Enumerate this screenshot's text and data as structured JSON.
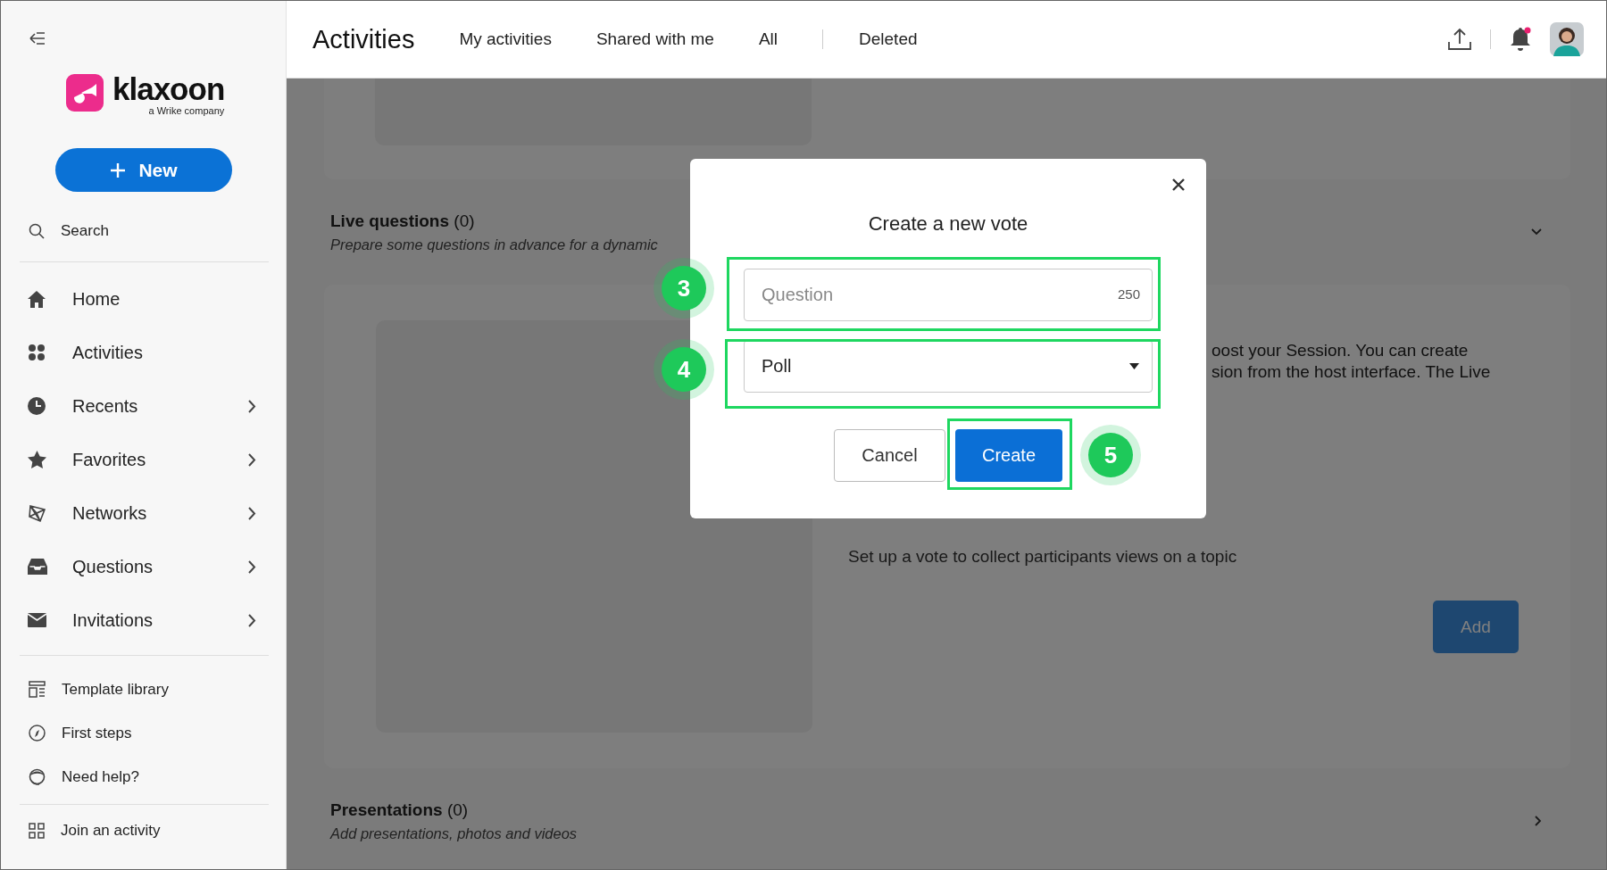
{
  "sidebar": {
    "logo": {
      "name": "klaxoon",
      "tagline": "a Wrike company"
    },
    "new_button": "New",
    "search": "Search",
    "nav_items": [
      {
        "label": "Home",
        "has_submenu": false
      },
      {
        "label": "Activities",
        "has_submenu": false
      },
      {
        "label": "Recents",
        "has_submenu": true
      },
      {
        "label": "Favorites",
        "has_submenu": true
      },
      {
        "label": "Networks",
        "has_submenu": true
      },
      {
        "label": "Questions",
        "has_submenu": true
      },
      {
        "label": "Invitations",
        "has_submenu": true
      }
    ],
    "links": [
      {
        "label": "Template library"
      },
      {
        "label": "First steps"
      },
      {
        "label": "Need help?"
      }
    ],
    "join_link": {
      "label": "Join an activity"
    }
  },
  "header": {
    "title": "Activities",
    "tabs": [
      {
        "label": "My activities",
        "divider_before": false
      },
      {
        "label": "Shared with me",
        "divider_before": false
      },
      {
        "label": "All",
        "divider_before": false
      },
      {
        "label": "Deleted",
        "divider_before": true
      }
    ],
    "notification_dot": true
  },
  "content": {
    "live_questions": {
      "title": "Live questions",
      "count": "(0)",
      "subtitle": "Prepare some questions in advance for a dynamic",
      "expanded": true
    },
    "vote_card": {
      "description_lines": [
        "oost your Session. You can create",
        "sion from the host interface. The Live"
      ],
      "text": "Set up a vote to collect participants views on a topic",
      "add_button": "Add"
    },
    "presentations": {
      "title": "Presentations",
      "count": "(0)",
      "subtitle": "Add presentations, photos and videos",
      "expanded": false
    }
  },
  "dialog": {
    "title": "Create a new vote",
    "question": {
      "placeholder": "Question",
      "counter": "250"
    },
    "type_select": {
      "value": "Poll"
    },
    "buttons": {
      "cancel": "Cancel",
      "create": "Create"
    }
  },
  "annotations": [
    {
      "number": "3"
    },
    {
      "number": "4"
    },
    {
      "number": "5"
    }
  ]
}
